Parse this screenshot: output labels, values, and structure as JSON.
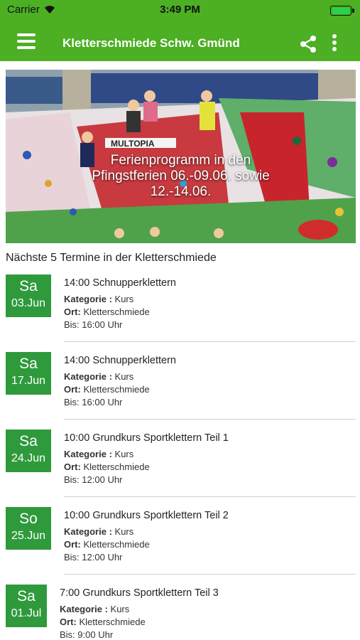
{
  "status_bar": {
    "carrier": "Carrier",
    "time": "3:49 PM",
    "battery_icon": "battery-full-icon",
    "wifi_icon": "wifi-icon"
  },
  "app_bar": {
    "title": "Kletterschmiede Schw. Gmünd",
    "menu_icon": "hamburger-menu-icon",
    "share_icon": "share-icon",
    "more_icon": "more-vertical-icon",
    "color": "#4caf24"
  },
  "banner": {
    "caption_line1": "Ferienprogramm in den",
    "caption_line2": "Pfingstferien 06.-09.06. sowie",
    "caption_line3": "12.-14.06.",
    "wall_sign": "MULTOPIA"
  },
  "section_title": "Nächste 5 Termine in der Kletterschmiede",
  "labels": {
    "category": "Kategorie :",
    "location": "Ort:",
    "until": "Bis:"
  },
  "events": [
    {
      "day": "Sa",
      "date": "03.Jun",
      "title": "14:00 Schnupperklettern",
      "category": "Kurs",
      "location": "Kletterschmiede",
      "until": "16:00 Uhr"
    },
    {
      "day": "Sa",
      "date": "17.Jun",
      "title": "14:00 Schnupperklettern",
      "category": "Kurs",
      "location": "Kletterschmiede",
      "until": "16:00 Uhr"
    },
    {
      "day": "Sa",
      "date": "24.Jun",
      "title": "10:00 Grundkurs Sportklettern Teil 1",
      "category": "Kurs",
      "location": "Kletterschmiede",
      "until": "12:00 Uhr"
    },
    {
      "day": "So",
      "date": "25.Jun",
      "title": "10:00 Grundkurs Sportklettern Teil 2",
      "category": "Kurs",
      "location": "Kletterschmiede",
      "until": "12:00 Uhr"
    },
    {
      "day": "Sa",
      "date": "01.Jul",
      "title": "7:00 Grundkurs Sportklettern Teil 3",
      "category": "Kurs",
      "location": "Kletterschmiede",
      "until": "9:00 Uhr"
    }
  ],
  "colors": {
    "date_box": "#2e9a3c",
    "divider": "#cfcfcf"
  }
}
